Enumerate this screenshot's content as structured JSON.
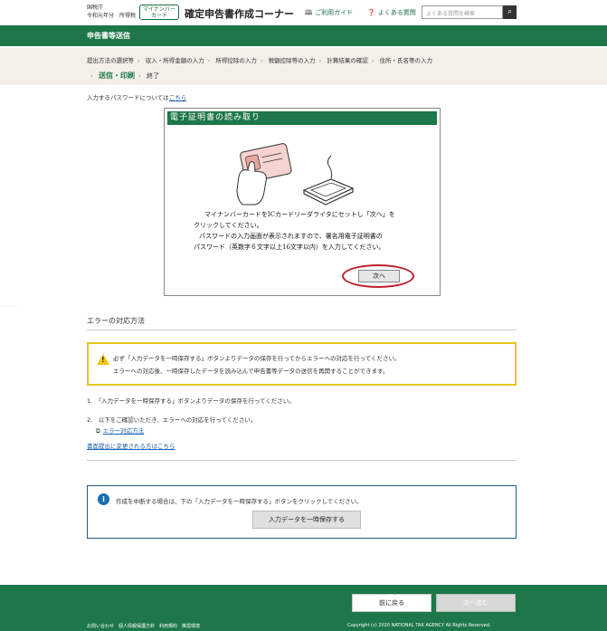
{
  "header": {
    "agency_line1": "国税庁",
    "agency_line2": "令和元年分　所得税",
    "myna_badge_line1": "マイナンバー",
    "myna_badge_line2": "カード",
    "site_title": "確定申告書作成コーナー",
    "help_link": "ご利用ガイド",
    "faq_link": "よくある質問",
    "search_placeholder": "よくある質問を検索",
    "search_button_icon": "magnifier-icon"
  },
  "section_title": "申告書等送信",
  "breadcrumb": {
    "steps": [
      "提出方法の選択等",
      "収入・所得金額の入力",
      "所得控除の入力",
      "税額控除等の入力",
      "計算結果の確認",
      "住所・氏名等の入力"
    ],
    "current": "送信・印刷",
    "last": "終了"
  },
  "password_note": {
    "text": "入力するパスワードについては",
    "link": "こちら"
  },
  "dialog": {
    "title": "電子証明書の読み取り",
    "line1": "マイナンバーカードをICカードリーダライタにセットし「次へ」を",
    "line2": "クリックしてください。",
    "line3": "パスワードの入力画面が表示されますので、署名用電子証明書の",
    "line4": "パスワード（英数字６文字以上16文字以内）を入力してください。",
    "next_button": "次へ"
  },
  "error_section": {
    "heading": "エラーの対応方法",
    "warning_line1": "必ず「入力データを一時保存する」ボタンよりデータの保存を行ってからエラーへの対応を行ってください。",
    "warning_line2": "エラーへの対応後、一時保存したデータを読み込んで申告書等データの送信を再開することができます。",
    "step1": "1.　「入力データを一時保存する」ボタンよりデータの保存を行ってください。",
    "step2": "2.　以下をご確認いただき、エラーへの対応を行ってください。",
    "error_link": "エラー対応方法",
    "paper_link": "書面提出に変更される方はこちら"
  },
  "info_box": {
    "text": "作成を中断する場合は、下の「入力データを一時保存する」ボタンをクリックしてください。",
    "save_button": "入力データを一時保存する"
  },
  "footer": {
    "prev_button": "前に戻る",
    "next_button": "次へ進む",
    "links": "お問い合わせ　個人情報保護方針　利用規約　推奨環境",
    "copyright": "Copyright (c) 2020 NATIONAL TAX AGENCY All Rights Reserved."
  },
  "colors": {
    "brand_green": "#1d7748",
    "warning_yellow": "#e8c61c",
    "info_blue": "#1a5a8a",
    "highlight_red": "#c0202a"
  }
}
